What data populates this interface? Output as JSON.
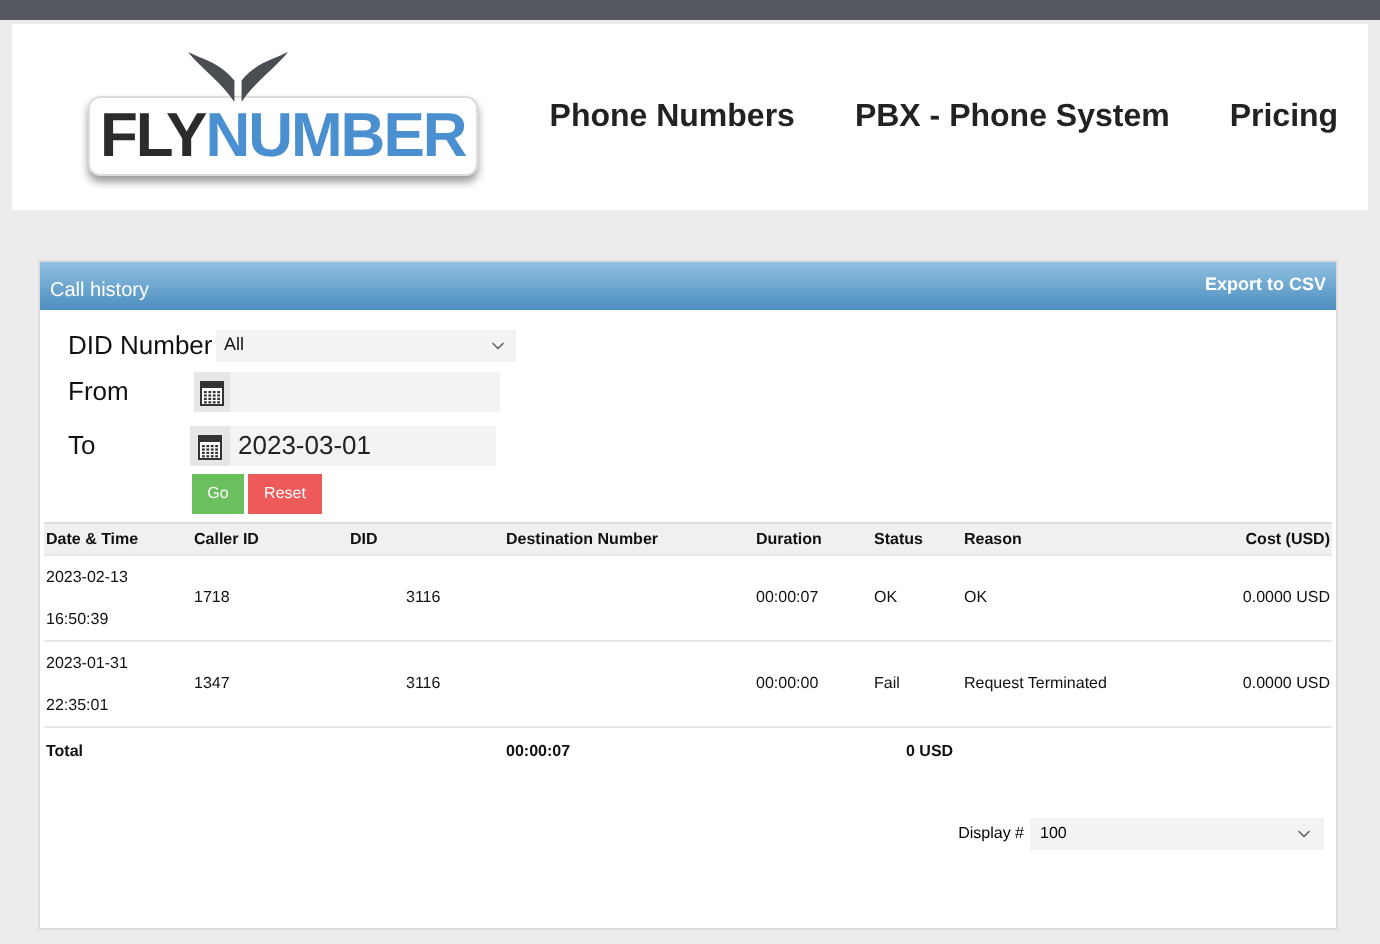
{
  "logo": {
    "part_1": "FLY",
    "part_2": "NUMBER"
  },
  "nav": [
    "Phone Numbers",
    "PBX - Phone System",
    "Pricing"
  ],
  "panel": {
    "title": "Call history",
    "export": "Export to CSV"
  },
  "filters": {
    "did_label": "DID Number",
    "did_value": "All",
    "from_label": "From",
    "to_label": "To",
    "to_value": "2023-03-01",
    "go": "Go",
    "reset": "Reset"
  },
  "table": {
    "columns": [
      "Date & Time",
      "Caller ID",
      "DID",
      "Destination Number",
      "Duration",
      "Status",
      "Reason",
      "Cost (USD)"
    ],
    "rows": [
      {
        "date": "2023-02-13",
        "time": "16:50:39",
        "caller_id": "1718",
        "did": "3116",
        "duration": "00:00:07",
        "status": "OK",
        "reason": "OK",
        "cost": "0.0000 USD"
      },
      {
        "date": "2023-01-31",
        "time": "22:35:01",
        "caller_id": "1347",
        "did": "3116",
        "duration": "00:00:00",
        "status": "Fail",
        "reason": "Request Terminated",
        "cost": "0.0000 USD"
      }
    ],
    "total": {
      "label": "Total",
      "duration": "00:00:07",
      "cost": "0 USD"
    }
  },
  "display": {
    "label": "Display #",
    "value": "100"
  }
}
